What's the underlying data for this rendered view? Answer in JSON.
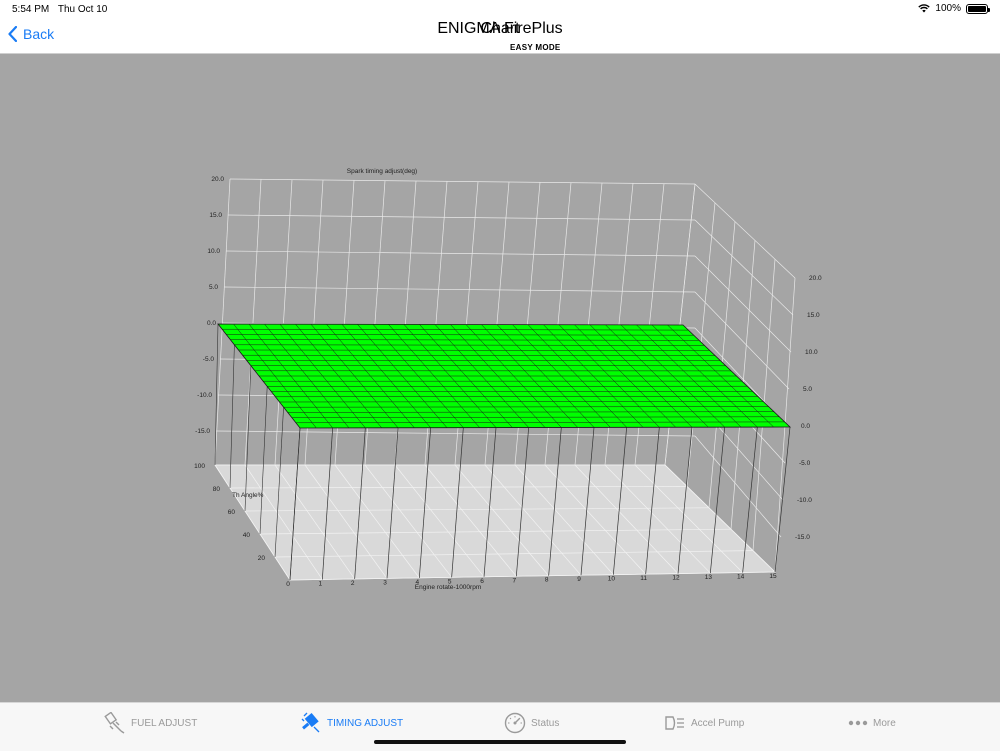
{
  "status_bar": {
    "time": "5:54 PM",
    "date": "Thu Oct 10",
    "battery": "100%"
  },
  "nav": {
    "back_label": "Back",
    "app_name": "ENIGMA FirePlus",
    "title": "Chart",
    "mode": "EASY MODE"
  },
  "chart_data": {
    "type": "surface3d",
    "title": "Spark timing adjust(deg)",
    "xlabel": "Engine rotate-1000rpm",
    "ylabel": "Th Angle%",
    "x_ticks": [
      0,
      1,
      2,
      3,
      4,
      5,
      6,
      7,
      8,
      9,
      10,
      11,
      12,
      13,
      14,
      15
    ],
    "y_ticks": [
      20,
      40,
      60,
      80,
      100
    ],
    "z_ticks_left": [
      "20.0",
      "15.0",
      "10.0",
      "5.0",
      "0.0",
      "-5.0",
      "-10.0",
      "-15.0"
    ],
    "z_ticks_right": [
      "20.0",
      "15.0",
      "10.0",
      "5.0",
      "0.0",
      "-5.0",
      "-10.0",
      "-15.0"
    ],
    "zlim": [
      -20,
      20
    ],
    "surface_value": 0.0,
    "surface_color": "#00ff00",
    "grid_rows": 20,
    "grid_cols": 30
  },
  "tabs": [
    {
      "label": "FUEL ADJUST",
      "icon": "injector-icon",
      "active": false
    },
    {
      "label": "TIMING ADJUST",
      "icon": "spark-plug-icon",
      "active": true
    },
    {
      "label": "Status",
      "icon": "gauge-icon",
      "active": false
    },
    {
      "label": "Accel Pump",
      "icon": "headlight-icon",
      "active": false
    },
    {
      "label": "More",
      "icon": "more-dots-icon",
      "active": false
    }
  ],
  "colors": {
    "accent": "#1a7cf5",
    "chart_background": "#a5a5a5",
    "surface": "#00ff00",
    "floor": "#d9d9d9"
  }
}
